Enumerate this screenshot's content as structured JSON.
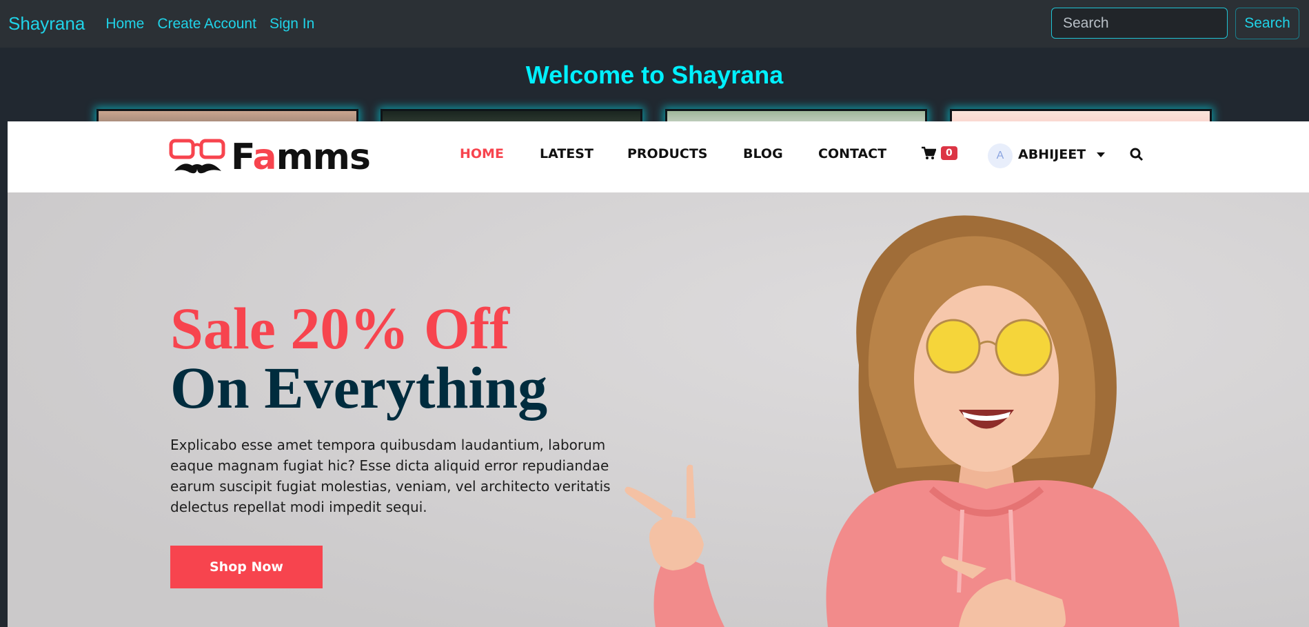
{
  "topbar": {
    "brand": "Shayrana",
    "links": [
      "Home",
      "Create Account",
      "Sign In"
    ],
    "search_placeholder": "Search",
    "search_button": "Search"
  },
  "welcome": "Welcome to Shayrana",
  "site": {
    "logo_prefix": "F",
    "logo_highlight": "a",
    "logo_suffix": "mms",
    "nav": [
      "HOME",
      "LATEST",
      "PRODUCTS",
      "BLOG",
      "CONTACT"
    ],
    "cart_count": "0",
    "avatar_initial": "A",
    "username": "ABHIJEET",
    "hero": {
      "line1": "Sale 20% Off",
      "line2": "On Everything",
      "description": "Explicabo esse amet tempora quibusdam laudantium, laborum eaque magnam fugiat hic? Esse dicta aliquid error repudiandae earum suscipit fugiat molestias, veniam, vel architecto veritatis delectus repellat modi impedit sequi.",
      "button": "Shop Now"
    }
  },
  "colors": {
    "accent_cyan": "#20d3e8",
    "brand_red": "#f7444e",
    "heading_navy": "#002c3e"
  }
}
